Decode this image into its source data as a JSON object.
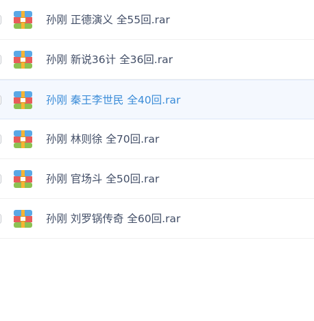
{
  "files": [
    {
      "name": "孙刚 正德演义 全55回.rar",
      "icon": "archive-icon",
      "selected": false
    },
    {
      "name": "孙刚 新说36计 全36回.rar",
      "icon": "archive-icon",
      "selected": false
    },
    {
      "name": "孙刚 秦王李世民 全40回.rar",
      "icon": "archive-icon",
      "selected": true
    },
    {
      "name": "孙刚 林则徐 全70回.rar",
      "icon": "archive-icon",
      "selected": false
    },
    {
      "name": "孙刚 官场斗 全50回.rar",
      "icon": "archive-icon",
      "selected": false
    },
    {
      "name": "孙刚 刘罗锅传奇 全60回.rar",
      "icon": "archive-icon",
      "selected": false
    }
  ],
  "colors": {
    "text": "#424e67",
    "selected_text": "#3b8cd8",
    "selected_bg": "#f4f8fe",
    "icon_top": "#5aa8e6",
    "icon_middle": "#e95b5b",
    "icon_bottom": "#8cc152",
    "icon_strap": "#f5b433"
  }
}
